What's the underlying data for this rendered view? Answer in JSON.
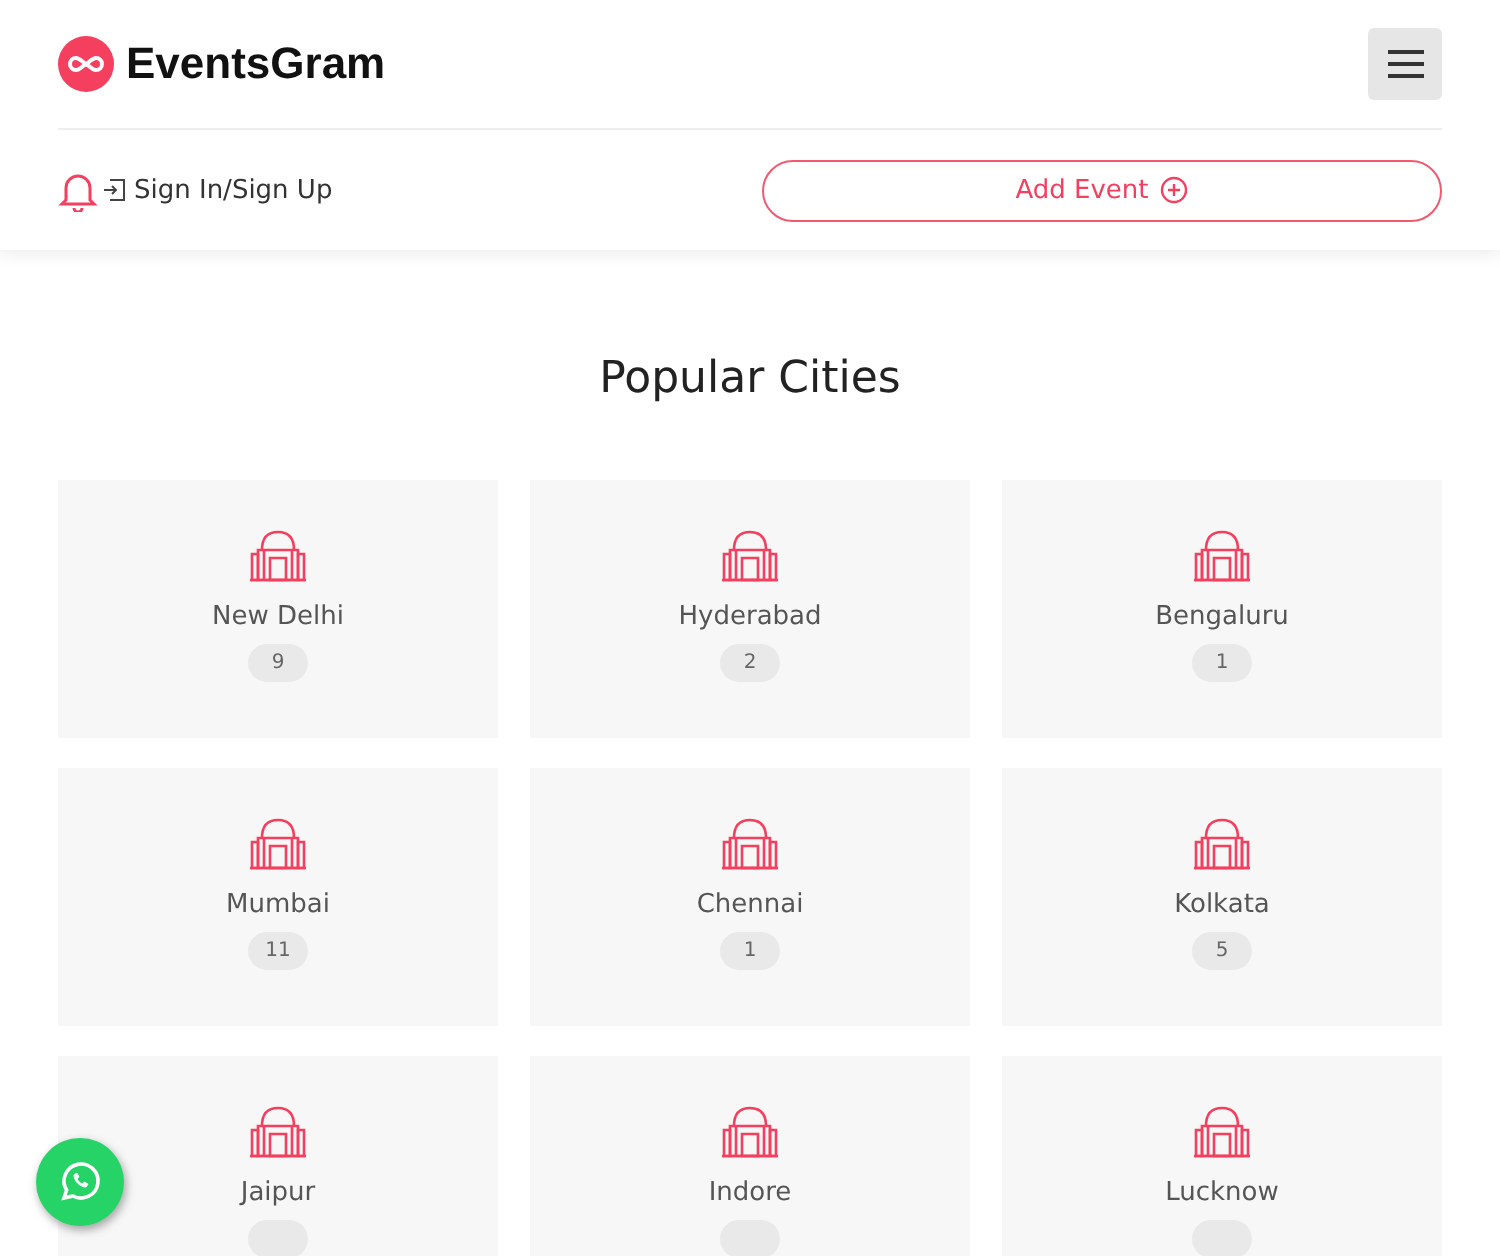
{
  "brand": "EventsGram",
  "signin": "Sign In/Sign Up",
  "add_event": "Add Event",
  "heading": "Popular Cities",
  "cities": [
    {
      "name": "New Delhi",
      "count": "9"
    },
    {
      "name": "Hyderabad",
      "count": "2"
    },
    {
      "name": "Bengaluru",
      "count": "1"
    },
    {
      "name": "Mumbai",
      "count": "11"
    },
    {
      "name": "Chennai",
      "count": "1"
    },
    {
      "name": "Kolkata",
      "count": "5"
    },
    {
      "name": "Jaipur"
    },
    {
      "name": "Indore"
    },
    {
      "name": "Lucknow"
    }
  ]
}
